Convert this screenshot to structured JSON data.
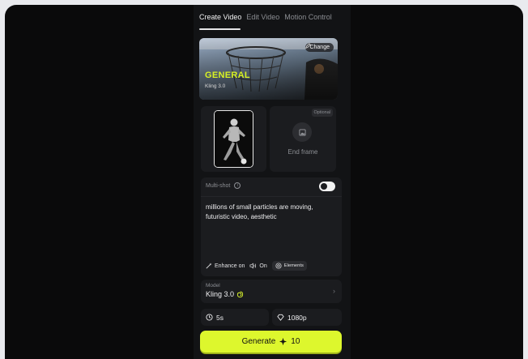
{
  "tabs": [
    {
      "label": "Create Video",
      "active": true
    },
    {
      "label": "Edit Video",
      "active": false
    },
    {
      "label": "Motion Control",
      "active": false
    }
  ],
  "hero": {
    "change_label": "Change",
    "title": "GENERAL",
    "subtitle": "Kling 3.0"
  },
  "frames": {
    "start_icon": "athlete-thumbnail",
    "optional_badge": "Optional",
    "end_label": "End frame",
    "end_icon": "image-icon"
  },
  "prompt": {
    "multishot_label": "Multi-shot",
    "multishot_on": true,
    "text": "millions of small particles are moving, futuristic video, aesthetic",
    "enhance_label": "Enhance on",
    "audio_label": "On",
    "elements_label": "Elements"
  },
  "model": {
    "label": "Model",
    "value": "Kling 3.0"
  },
  "options": {
    "duration": "5s",
    "resolution": "1080p"
  },
  "generate": {
    "label": "Generate",
    "cost": "10"
  },
  "colors": {
    "accent": "#ddf72d",
    "background": "#0a0a0b",
    "panel": "#121315",
    "card": "#1b1c1f"
  }
}
